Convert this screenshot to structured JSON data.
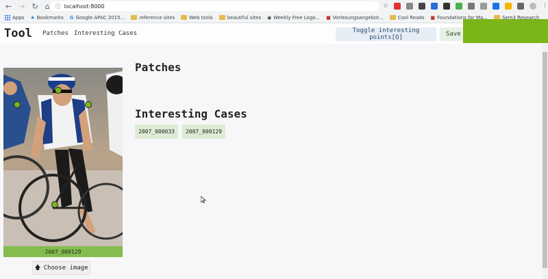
{
  "browser": {
    "url": "localhost:8000",
    "bookmarks": [
      {
        "label": "Apps",
        "icon": "apps-grid-icon"
      },
      {
        "label": "Bookmarks",
        "icon": "star-icon"
      },
      {
        "label": "Google APAC 2015...",
        "icon": "google-icon"
      },
      {
        "label": "reference sites",
        "icon": "folder-icon"
      },
      {
        "label": "Web tools",
        "icon": "folder-icon"
      },
      {
        "label": "beautiful sites",
        "icon": "folder-icon"
      },
      {
        "label": "Weekly Free Logo...",
        "icon": "globe-icon"
      },
      {
        "label": "Vorlesungsangebot...",
        "icon": "site-icon"
      },
      {
        "label": "Cool Reads",
        "icon": "folder-icon"
      },
      {
        "label": "Foundations for Ma...",
        "icon": "site-icon"
      },
      {
        "label": "Sem3 Research",
        "icon": "folder-icon"
      }
    ]
  },
  "app": {
    "brand": "Tool",
    "nav": [
      "Patches",
      "Interesting Cases"
    ],
    "toggle_label": "Toggle interesting points[Q]",
    "save_label": "Save I"
  },
  "image_card": {
    "caption": "2007_000129",
    "choose_label": "Choose image"
  },
  "main": {
    "patches_title": "Patches",
    "cases_title": "Interesting Cases",
    "cases": [
      "2007_000033",
      "2007_000129"
    ]
  },
  "colors": {
    "accent_green": "#7bb518",
    "caption_green": "#84bc50",
    "case_bg": "#deebd5",
    "toggle_bg": "#e6edf5"
  }
}
